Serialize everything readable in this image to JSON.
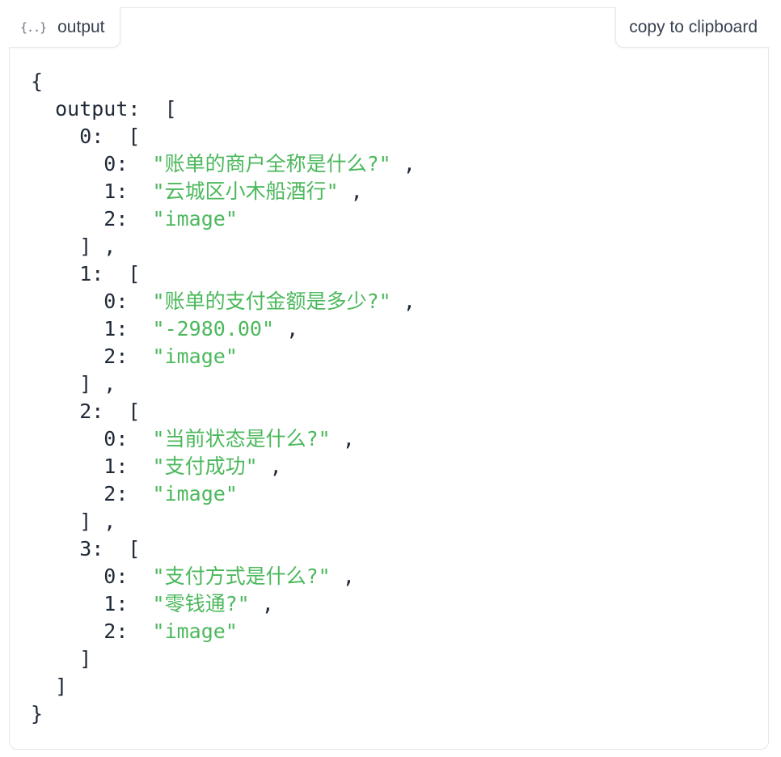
{
  "tab": {
    "icon": "braces-icon",
    "icon_glyph": "{..}",
    "label": "output"
  },
  "copy_button": {
    "label": "copy to clipboard"
  },
  "json_view": {
    "root_key": "output",
    "items": [
      {
        "index": "0",
        "values": [
          "账单的商户全称是什么?",
          "云城区小木船酒行",
          "image"
        ]
      },
      {
        "index": "1",
        "values": [
          "账单的支付金额是多少?",
          "-2980.00",
          "image"
        ]
      },
      {
        "index": "2",
        "values": [
          "当前状态是什么?",
          "支付成功",
          "image"
        ]
      },
      {
        "index": "3",
        "values": [
          "支付方式是什么?",
          "零钱通?",
          "image"
        ]
      }
    ]
  },
  "colors": {
    "string": "#4cb85c",
    "text": "#1f2937",
    "border": "#e5e7eb"
  }
}
